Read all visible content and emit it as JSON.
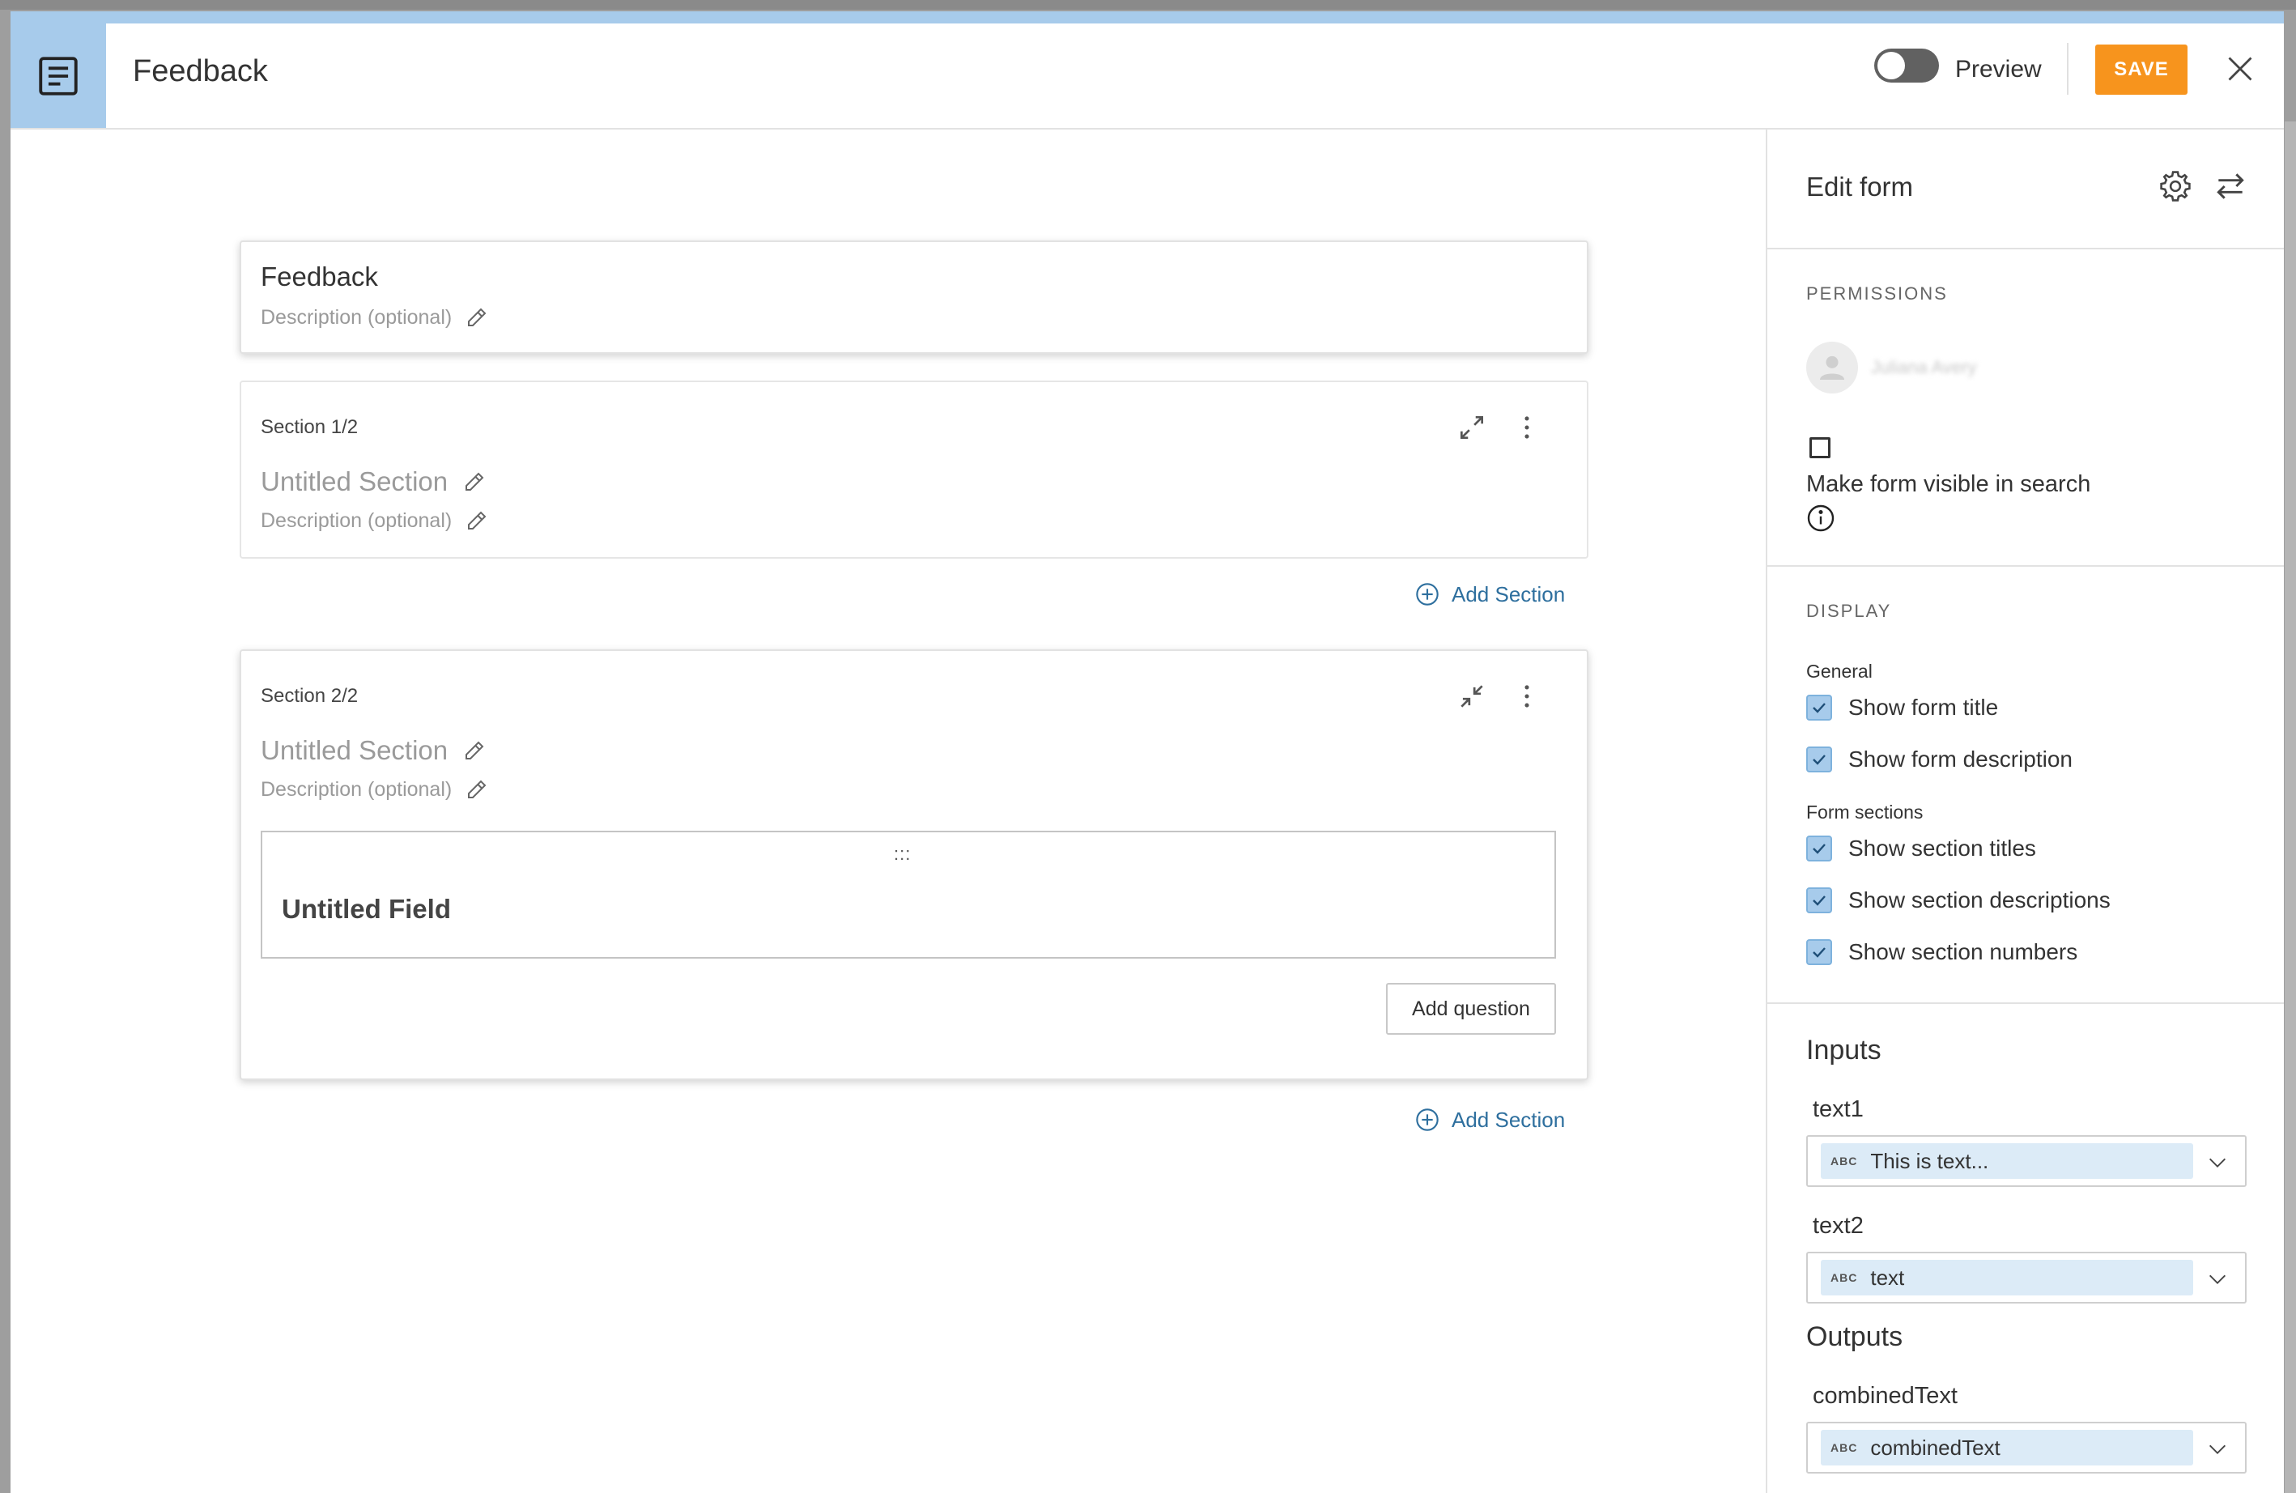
{
  "header": {
    "title": "Feedback",
    "preview_label": "Preview",
    "save_label": "SAVE",
    "preview_enabled": false
  },
  "form": {
    "title": "Feedback",
    "description_placeholder": "Description (optional)"
  },
  "sections": [
    {
      "label": "Section 1/2",
      "title": "Untitled Section",
      "description_placeholder": "Description (optional)",
      "expanded": false
    },
    {
      "label": "Section 2/2",
      "title": "Untitled Section",
      "description_placeholder": "Description (optional)",
      "expanded": true,
      "fields": [
        {
          "drag_handle": ":::",
          "title": "Untitled Field"
        }
      ],
      "add_question_label": "Add question"
    }
  ],
  "add_section_label": "Add Section",
  "panel": {
    "title": "Edit form",
    "permissions": {
      "heading": "PERMISSIONS",
      "user_name": "Juliana Avery",
      "visible_in_search_label": "Make form visible in search",
      "visible_in_search_checked": false
    },
    "display": {
      "heading": "DISPLAY",
      "general_label": "General",
      "general_options": [
        {
          "label": "Show form title",
          "checked": true
        },
        {
          "label": "Show form description",
          "checked": true
        }
      ],
      "sections_label": "Form sections",
      "section_options": [
        {
          "label": "Show section titles",
          "checked": true
        },
        {
          "label": "Show section descriptions",
          "checked": true
        },
        {
          "label": "Show section numbers",
          "checked": true
        }
      ]
    },
    "inputs_heading": "Inputs",
    "inputs": [
      {
        "name": "text1",
        "type": "ABC",
        "value": "This is text..."
      },
      {
        "name": "text2",
        "type": "ABC",
        "value": "text"
      }
    ],
    "outputs_heading": "Outputs",
    "outputs": [
      {
        "name": "combinedText",
        "type": "ABC",
        "value": "combinedText"
      }
    ]
  },
  "colors": {
    "accent": "#a7cbeb",
    "save": "#f7941d",
    "link": "#2e6f9e",
    "chip": "#dcebf7"
  }
}
